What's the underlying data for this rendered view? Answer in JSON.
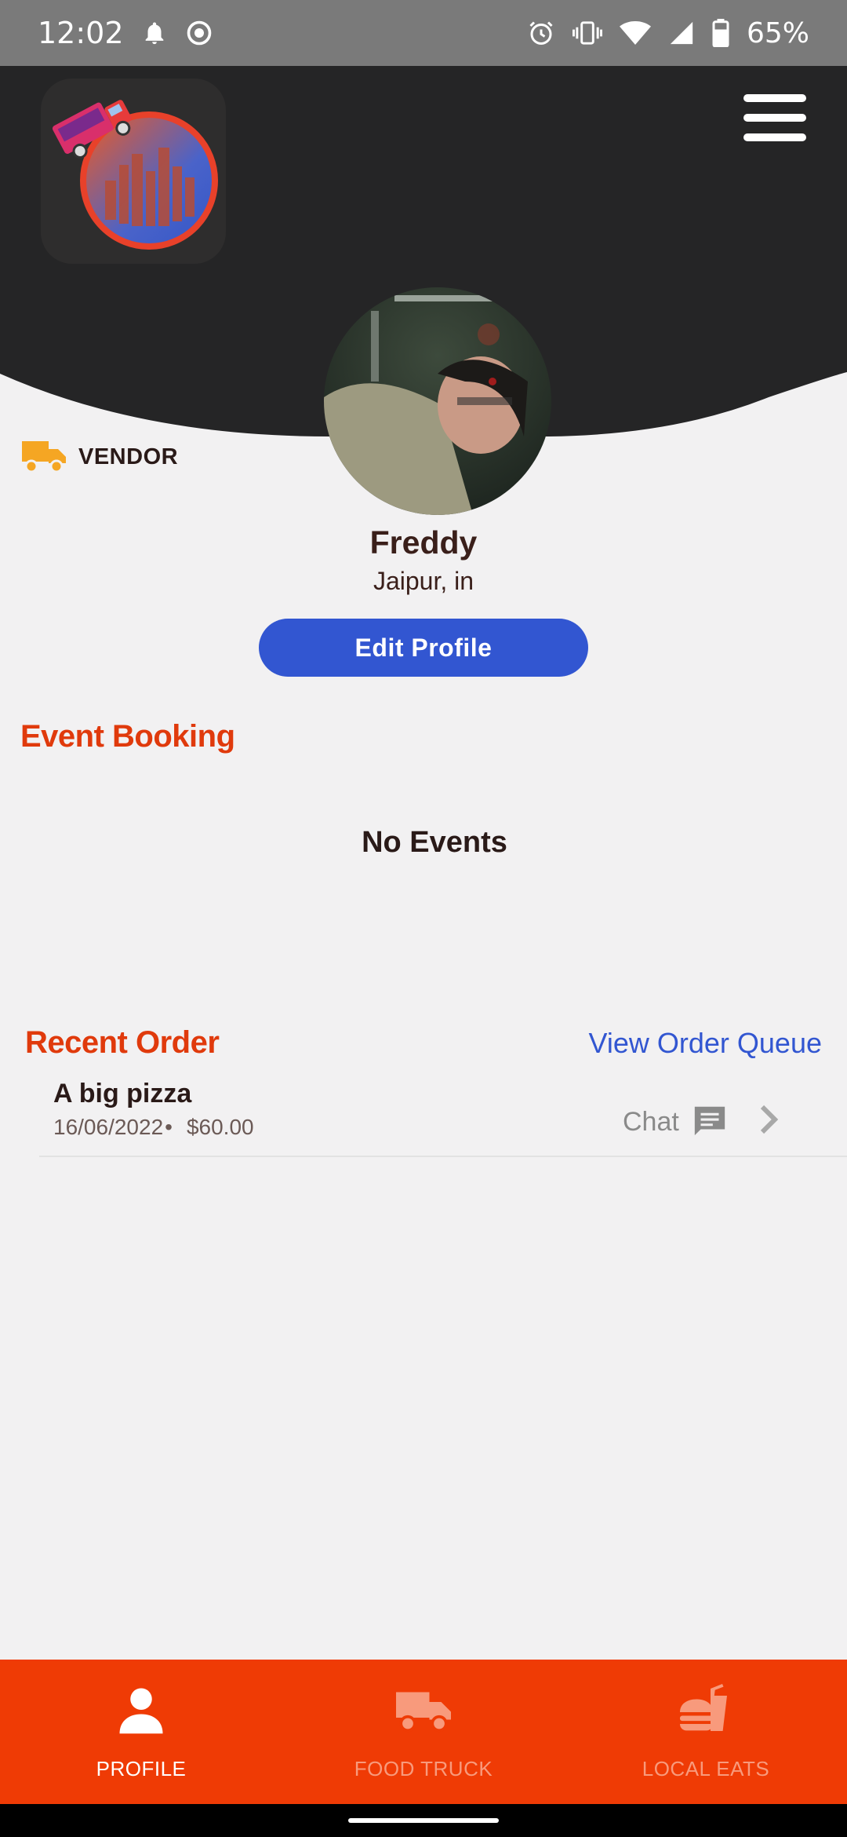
{
  "status_bar": {
    "time": "12:02",
    "battery_percent": "65%",
    "icons": [
      "bell-icon",
      "screen-record-icon",
      "alarm-icon",
      "vibrate-icon",
      "wifi-icon",
      "signal-icon",
      "battery-icon"
    ]
  },
  "header": {
    "logo_icon": "food-truck-city-logo",
    "menu_icon": "hamburger-menu-icon"
  },
  "profile": {
    "role_label": "VENDOR",
    "role_icon": "truck-icon",
    "name": "Freddy",
    "location": "Jaipur, in",
    "edit_button_label": "Edit Profile"
  },
  "event_booking": {
    "title": "Event Booking",
    "empty_text": "No Events"
  },
  "recent_order": {
    "title": "Recent Order",
    "view_queue_label": "View Order Queue",
    "orders": [
      {
        "name": "A big pizza",
        "date": "16/06/2022",
        "separator": "•",
        "price": "$60.00",
        "chat_label": "Chat"
      }
    ]
  },
  "bottom_nav": {
    "items": [
      {
        "label": "PROFILE",
        "icon": "person-icon",
        "active": true
      },
      {
        "label": "FOOD TRUCK",
        "icon": "truck-icon",
        "active": false
      },
      {
        "label": "LOCAL EATS",
        "icon": "fast-food-icon",
        "active": false
      }
    ]
  },
  "colors": {
    "accent": "#ef3b05",
    "section_title": "#e03a0c",
    "link": "#3256d1",
    "header_bg": "#252526",
    "page_bg": "#f2f1f2"
  }
}
